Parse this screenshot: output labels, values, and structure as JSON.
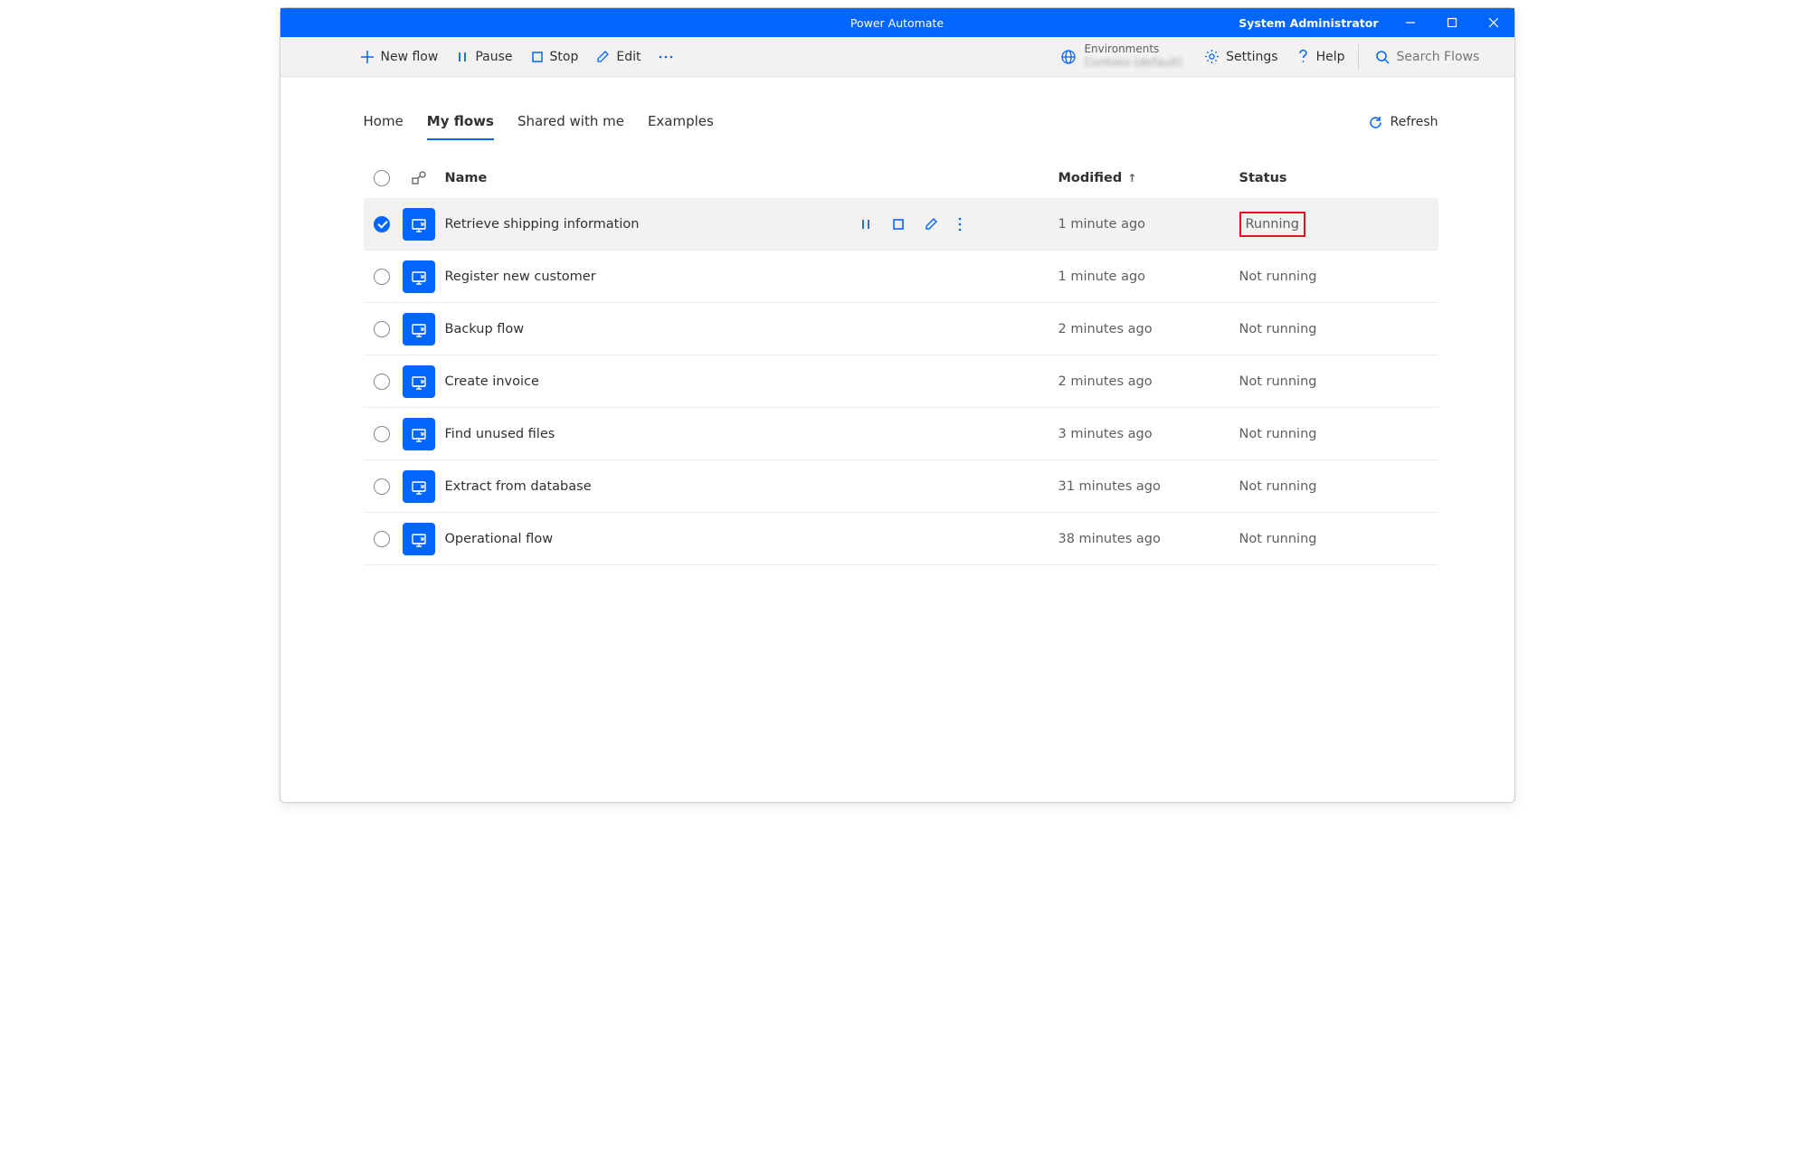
{
  "window": {
    "title": "Power Automate",
    "user": "System Administrator"
  },
  "toolbar": {
    "new": "New flow",
    "pause": "Pause",
    "stop": "Stop",
    "edit": "Edit",
    "env_label": "Environments",
    "env_value": "Contoso (default)",
    "settings": "Settings",
    "help": "Help",
    "search_placeholder": "Search Flows"
  },
  "tabs": {
    "home": "Home",
    "myflows": "My flows",
    "shared": "Shared with me",
    "examples": "Examples"
  },
  "refresh": "Refresh",
  "columns": {
    "name": "Name",
    "modified": "Modified",
    "status": "Status"
  },
  "rows": [
    {
      "name": "Retrieve shipping information",
      "modified": "1 minute ago",
      "status": "Running",
      "selected": true,
      "highlight": true
    },
    {
      "name": "Register new customer",
      "modified": "1 minute ago",
      "status": "Not running"
    },
    {
      "name": "Backup flow",
      "modified": "2 minutes ago",
      "status": "Not running"
    },
    {
      "name": "Create invoice",
      "modified": "2 minutes ago",
      "status": "Not running"
    },
    {
      "name": "Find unused files",
      "modified": "3 minutes ago",
      "status": "Not running"
    },
    {
      "name": "Extract from database",
      "modified": "31 minutes ago",
      "status": "Not running"
    },
    {
      "name": "Operational flow",
      "modified": "38 minutes ago",
      "status": "Not running"
    }
  ]
}
